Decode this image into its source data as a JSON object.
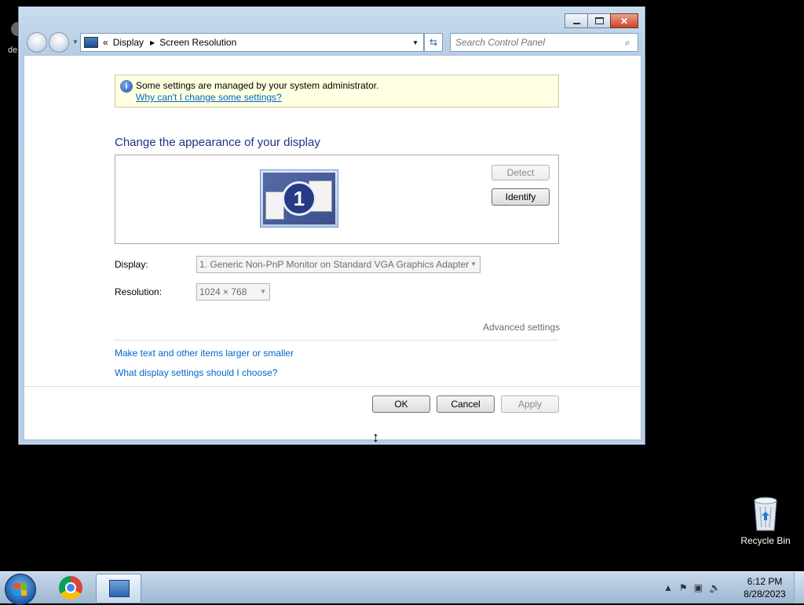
{
  "desktop": {
    "left_icon_label": "de",
    "recycle_bin_label": "Recycle Bin"
  },
  "window": {
    "address": {
      "breadcrumb_overflow": "«",
      "crumbs": [
        "Display",
        "Screen Resolution"
      ]
    },
    "search_placeholder": "Search Control Panel",
    "infobar": {
      "message": "Some settings are managed by your system administrator.",
      "link": "Why can't I change some settings?"
    },
    "heading": "Change the appearance of your display",
    "monitor_number": "1",
    "detect_label": "Detect",
    "identify_label": "Identify",
    "display_label": "Display:",
    "display_value": "1. Generic Non-PnP Monitor on Standard VGA Graphics Adapter",
    "resolution_label": "Resolution:",
    "resolution_value": "1024 × 768",
    "advanced_settings": "Advanced settings",
    "links": {
      "text_size": "Make text and other items larger or smaller",
      "which_settings": "What display settings should I choose?"
    },
    "ok_label": "OK",
    "cancel_label": "Cancel",
    "apply_label": "Apply"
  },
  "taskbar": {
    "time": "6:12 PM",
    "date": "8/28/2023",
    "tray_icons": [
      "show-hidden-icons-arrow",
      "action-center-icon",
      "network-icon",
      "volume-muted-icon"
    ],
    "pinned": [
      "start-button",
      "chrome-icon",
      "control-panel-icon"
    ]
  },
  "colors": {
    "heading": "#1e3287",
    "link": "#0066cc",
    "infobar_bg": "#ffffe1"
  }
}
